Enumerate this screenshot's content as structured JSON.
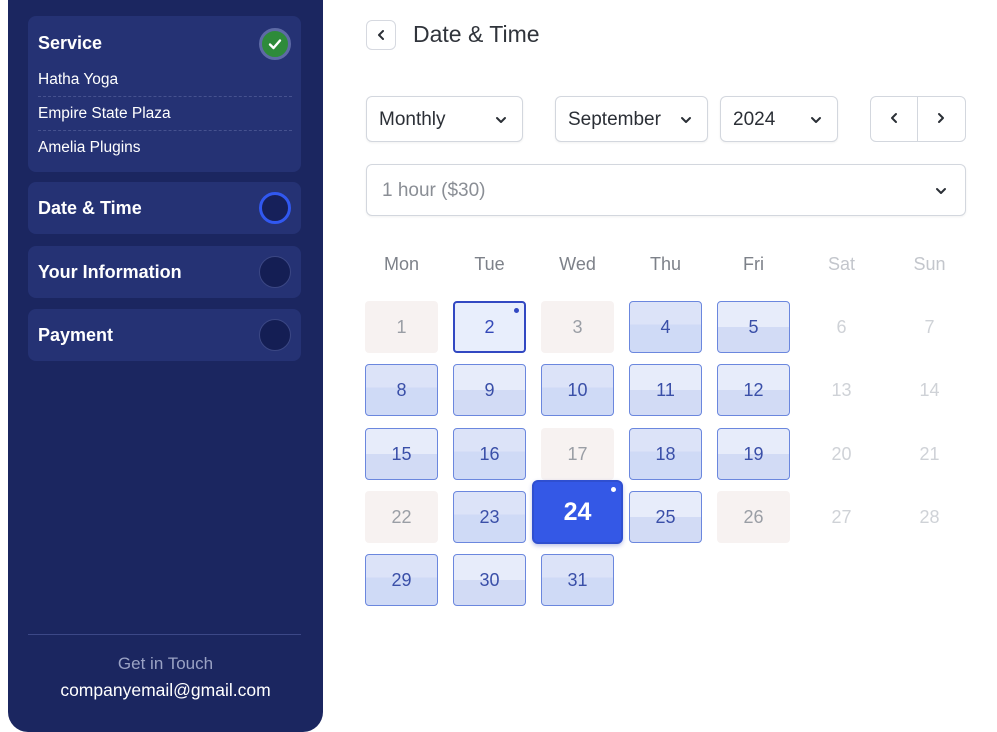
{
  "sidebar": {
    "service": {
      "title": "Service",
      "items": [
        "Hatha Yoga",
        "Empire State Plaza",
        "Amelia Plugins"
      ]
    },
    "steps": [
      {
        "title": "Date & Time",
        "state": "active"
      },
      {
        "title": "Your Information",
        "state": "pending"
      },
      {
        "title": "Payment",
        "state": "pending"
      }
    ],
    "footer": {
      "heading": "Get in Touch",
      "email": "companyemail@gmail.com"
    }
  },
  "header": {
    "title": "Date & Time"
  },
  "controls": {
    "view": "Monthly",
    "month": "September",
    "year": "2024",
    "duration": "1 hour ($30)"
  },
  "calendar": {
    "weekdays": [
      "Mon",
      "Tue",
      "Wed",
      "Thu",
      "Fri",
      "Sat",
      "Sun"
    ],
    "selected_day": "24",
    "today": "2",
    "days": [
      {
        "n": "1",
        "state": "inactive"
      },
      {
        "n": "2",
        "state": "today"
      },
      {
        "n": "3",
        "state": "inactive"
      },
      {
        "n": "4",
        "state": "avail"
      },
      {
        "n": "5",
        "state": "avail-alt"
      },
      {
        "n": "6",
        "state": "weekend"
      },
      {
        "n": "7",
        "state": "weekend"
      },
      {
        "n": "8",
        "state": "avail"
      },
      {
        "n": "9",
        "state": "avail-alt"
      },
      {
        "n": "10",
        "state": "avail"
      },
      {
        "n": "11",
        "state": "avail-alt"
      },
      {
        "n": "12",
        "state": "avail-alt"
      },
      {
        "n": "13",
        "state": "weekend"
      },
      {
        "n": "14",
        "state": "weekend"
      },
      {
        "n": "15",
        "state": "avail-alt"
      },
      {
        "n": "16",
        "state": "avail"
      },
      {
        "n": "17",
        "state": "inactive"
      },
      {
        "n": "18",
        "state": "avail"
      },
      {
        "n": "19",
        "state": "avail-alt"
      },
      {
        "n": "20",
        "state": "weekend"
      },
      {
        "n": "21",
        "state": "weekend"
      },
      {
        "n": "22",
        "state": "inactive"
      },
      {
        "n": "23",
        "state": "avail"
      },
      {
        "n": "24",
        "state": "selected"
      },
      {
        "n": "25",
        "state": "avail-alt"
      },
      {
        "n": "26",
        "state": "inactive"
      },
      {
        "n": "27",
        "state": "weekend"
      },
      {
        "n": "28",
        "state": "weekend"
      },
      {
        "n": "29",
        "state": "avail"
      },
      {
        "n": "30",
        "state": "avail-alt"
      },
      {
        "n": "31",
        "state": "avail"
      }
    ]
  },
  "colors": {
    "sidebar_bg": "#1b2660",
    "accent": "#3458e6",
    "success": "#2e8b3a"
  }
}
